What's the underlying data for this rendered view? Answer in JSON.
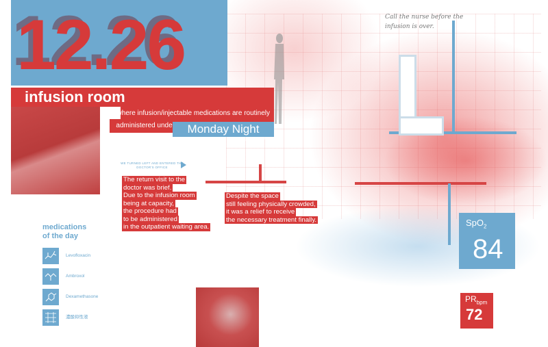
{
  "header": {
    "date": "12.26",
    "title": "infusion room",
    "subtitle": "where infusion/injectable medications are routinely administered under the supervision of a healthcare provider",
    "time_of_day": "Monday Night"
  },
  "handwritten_note": "Call the nurse before the infusion is over.",
  "direction_caption": "WE TURNED LEFT AND ENTERED THE DOCTOR'S OFFICE",
  "story": {
    "left_lines": [
      "The return visit to the",
      "doctor was brief.",
      "Due to the infusion room",
      "being at capacity,",
      "the procedure had",
      "to be administered",
      "in the outpatient waiting area."
    ],
    "right_lines": [
      "Despite the space",
      "still feeling physically crowded,",
      "it was a relief to receive",
      "the necessary treatment finally."
    ]
  },
  "medications": {
    "title_line1": "medications",
    "title_line2": "of the day",
    "items": [
      {
        "name": "Levofloxacin",
        "icon": "molecule-icon"
      },
      {
        "name": "Ambroxol",
        "icon": "molecule-icon"
      },
      {
        "name": "Dexamethasone",
        "icon": "molecule-icon"
      },
      {
        "name": "濃酸抑性液",
        "icon": "molecule-icon"
      }
    ]
  },
  "vitals": {
    "spo2_label": "SpO",
    "spo2_sub": "2",
    "spo2_value": "84",
    "pr_label": "PR",
    "pr_sub": "bpm",
    "pr_value": "72"
  },
  "colors": {
    "red": "#d63a3a",
    "blue": "#6ea9cf"
  }
}
